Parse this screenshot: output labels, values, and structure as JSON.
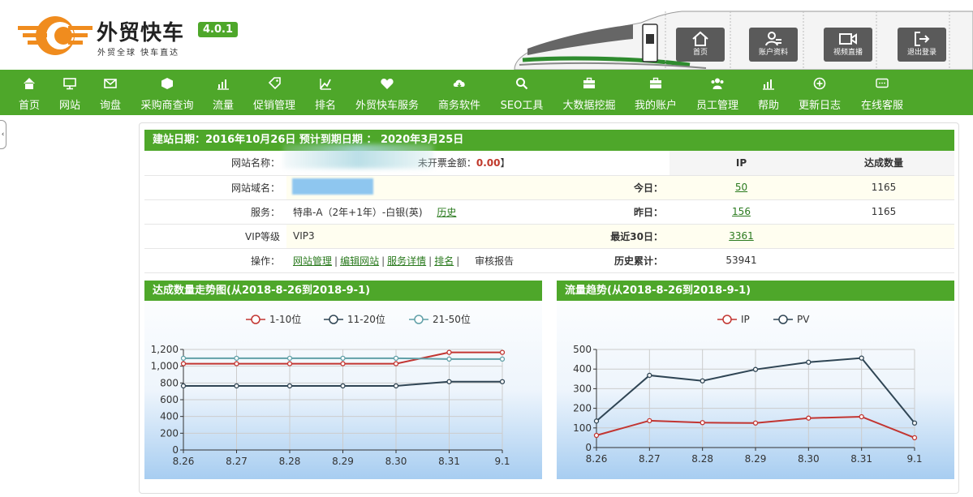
{
  "brand": {
    "title": "外贸快车",
    "slogan": "外贸全球 快车直达",
    "version": "4.0.1",
    "accent_color": "#4ea72a",
    "logo_color": "#f08c1e"
  },
  "top_buttons": [
    {
      "label": "首页",
      "icon": "home-icon"
    },
    {
      "label": "账户资料",
      "icon": "user-edit-icon"
    },
    {
      "label": "视频直播",
      "icon": "video-camera-icon"
    },
    {
      "label": "退出登录",
      "icon": "logout-icon"
    }
  ],
  "nav": [
    {
      "label": "首页",
      "icon": "home-icon"
    },
    {
      "label": "网站",
      "icon": "monitor-icon"
    },
    {
      "label": "询盘",
      "icon": "envelope-icon"
    },
    {
      "label": "采购商查询",
      "icon": "box-icon"
    },
    {
      "label": "流量",
      "icon": "bar-chart-icon"
    },
    {
      "label": "促销管理",
      "icon": "tag-icon"
    },
    {
      "label": "排名",
      "icon": "trend-icon"
    },
    {
      "label": "外贸快车服务",
      "icon": "heart-icon"
    },
    {
      "label": "商务软件",
      "icon": "cloud-download-icon"
    },
    {
      "label": "SEO工具",
      "icon": "magnifier-icon"
    },
    {
      "label": "大数据挖掘",
      "icon": "briefcase-icon"
    },
    {
      "label": "我的账户",
      "icon": "briefcase-icon"
    },
    {
      "label": "员工管理",
      "icon": "users-icon"
    },
    {
      "label": "帮助",
      "icon": "bar-chart-icon"
    },
    {
      "label": "更新日志",
      "icon": "plus-circle-icon"
    },
    {
      "label": "在线客服",
      "icon": "chat-icon"
    }
  ],
  "side_toggle": "‹",
  "info": {
    "header": "建站日期：2016年10月26日   预计到期日期 ： 2020年3月25日",
    "rows": {
      "name_label": "网站名称：",
      "name_extra_label": "未开票金额：",
      "name_extra_value": "0.00",
      "name_extra_close": "】",
      "domain_label": "网站域名：",
      "service_label": "服务：",
      "service_value": "特串-A（2年+1年）-白银(英)",
      "service_link": "历史",
      "vip_label": "VIP等级",
      "vip_value": "VIP3",
      "ops_label": "操作：",
      "ops_links": [
        "网站管理",
        "编辑网站",
        "服务详情",
        "排名"
      ],
      "ops_plain": "审核报告"
    },
    "stats": {
      "col_ip": "IP",
      "col_done": "达成数量",
      "rows": [
        {
          "label": "今日：",
          "ip": "50",
          "done": "1165"
        },
        {
          "label": "昨日：",
          "ip": "156",
          "done": "1165"
        },
        {
          "label": "最近30日：",
          "ip": "3361",
          "done": ""
        },
        {
          "label": "历史累计：",
          "ip": "53941",
          "done": ""
        }
      ]
    }
  },
  "chart_data": [
    {
      "type": "line",
      "title": "达成数量走势图(从2018-8-26到2018-9-1)",
      "categories": [
        "8.26",
        "8.27",
        "8.28",
        "8.29",
        "8.30",
        "8.31",
        "9.1"
      ],
      "ylim": [
        0,
        1200
      ],
      "yticks": [
        0,
        200,
        400,
        600,
        800,
        1000,
        1200
      ],
      "ytick_labels": [
        "0",
        "200",
        "400",
        "600",
        "800",
        "1,000",
        "1,200"
      ],
      "grid": true,
      "legend": "top-center",
      "series": [
        {
          "name": "1-10位",
          "color": "#c23531",
          "values": [
            1030,
            1030,
            1030,
            1030,
            1030,
            1165,
            1165
          ]
        },
        {
          "name": "11-20位",
          "color": "#2f4554",
          "values": [
            765,
            765,
            765,
            765,
            765,
            815,
            815
          ]
        },
        {
          "name": "21-50位",
          "color": "#61a0a8",
          "values": [
            1095,
            1095,
            1095,
            1095,
            1095,
            1085,
            1085
          ]
        }
      ]
    },
    {
      "type": "line",
      "title": "流量趋势(从2018-8-26到2018-9-1)",
      "categories": [
        "8.26",
        "8.27",
        "8.28",
        "8.29",
        "8.30",
        "8.31",
        "9.1"
      ],
      "ylim": [
        0,
        500
      ],
      "yticks": [
        0,
        100,
        200,
        300,
        400,
        500
      ],
      "ytick_labels": [
        "0",
        "100",
        "200",
        "300",
        "400",
        "500"
      ],
      "grid": true,
      "legend": "top-center",
      "series": [
        {
          "name": "IP",
          "color": "#c23531",
          "values": [
            62,
            137,
            127,
            125,
            150,
            157,
            50
          ]
        },
        {
          "name": "PV",
          "color": "#2f4554",
          "values": [
            135,
            368,
            340,
            398,
            435,
            456,
            125
          ]
        }
      ]
    }
  ]
}
